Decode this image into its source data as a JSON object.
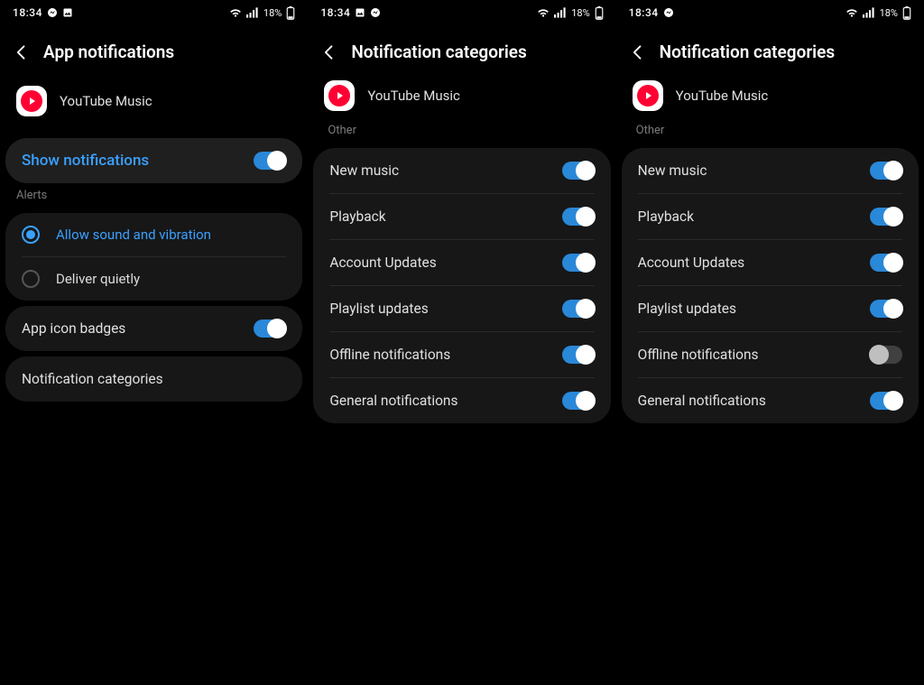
{
  "status": {
    "time": "18:34",
    "battery": "18%"
  },
  "screens": [
    {
      "title": "App notifications",
      "appName": "YouTube Music",
      "showNotifications": {
        "label": "Show notifications",
        "on": true
      },
      "alertsHeader": "Alerts",
      "radios": [
        {
          "label": "Allow sound and vibration",
          "selected": true
        },
        {
          "label": "Deliver quietly",
          "selected": false
        }
      ],
      "badges": {
        "label": "App icon badges",
        "on": true
      },
      "categories": {
        "label": "Notification categories"
      }
    },
    {
      "title": "Notification categories",
      "appName": "YouTube Music",
      "groupHeader": "Other",
      "items": [
        {
          "label": "New music",
          "on": true
        },
        {
          "label": "Playback",
          "on": true
        },
        {
          "label": "Account Updates",
          "on": true
        },
        {
          "label": "Playlist updates",
          "on": true
        },
        {
          "label": "Offline notifications",
          "on": true
        },
        {
          "label": "General notifications",
          "on": true
        }
      ]
    },
    {
      "title": "Notification categories",
      "appName": "YouTube Music",
      "groupHeader": "Other",
      "items": [
        {
          "label": "New music",
          "on": true
        },
        {
          "label": "Playback",
          "on": true
        },
        {
          "label": "Account Updates",
          "on": true
        },
        {
          "label": "Playlist updates",
          "on": true
        },
        {
          "label": "Offline notifications",
          "on": false
        },
        {
          "label": "General notifications",
          "on": true
        }
      ]
    }
  ]
}
